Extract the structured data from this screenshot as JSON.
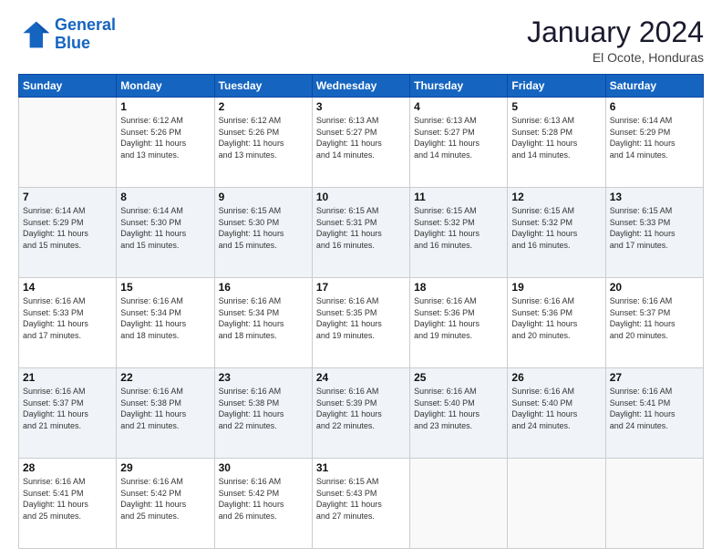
{
  "logo": {
    "line1": "General",
    "line2": "Blue"
  },
  "header": {
    "month": "January 2024",
    "location": "El Ocote, Honduras"
  },
  "weekdays": [
    "Sunday",
    "Monday",
    "Tuesday",
    "Wednesday",
    "Thursday",
    "Friday",
    "Saturday"
  ],
  "weeks": [
    [
      {
        "day": "",
        "sunrise": "",
        "sunset": "",
        "daylight": ""
      },
      {
        "day": "1",
        "sunrise": "Sunrise: 6:12 AM",
        "sunset": "Sunset: 5:26 PM",
        "daylight": "Daylight: 11 hours and 13 minutes."
      },
      {
        "day": "2",
        "sunrise": "Sunrise: 6:12 AM",
        "sunset": "Sunset: 5:26 PM",
        "daylight": "Daylight: 11 hours and 13 minutes."
      },
      {
        "day": "3",
        "sunrise": "Sunrise: 6:13 AM",
        "sunset": "Sunset: 5:27 PM",
        "daylight": "Daylight: 11 hours and 14 minutes."
      },
      {
        "day": "4",
        "sunrise": "Sunrise: 6:13 AM",
        "sunset": "Sunset: 5:27 PM",
        "daylight": "Daylight: 11 hours and 14 minutes."
      },
      {
        "day": "5",
        "sunrise": "Sunrise: 6:13 AM",
        "sunset": "Sunset: 5:28 PM",
        "daylight": "Daylight: 11 hours and 14 minutes."
      },
      {
        "day": "6",
        "sunrise": "Sunrise: 6:14 AM",
        "sunset": "Sunset: 5:29 PM",
        "daylight": "Daylight: 11 hours and 14 minutes."
      }
    ],
    [
      {
        "day": "7",
        "sunrise": "Sunrise: 6:14 AM",
        "sunset": "Sunset: 5:29 PM",
        "daylight": "Daylight: 11 hours and 15 minutes."
      },
      {
        "day": "8",
        "sunrise": "Sunrise: 6:14 AM",
        "sunset": "Sunset: 5:30 PM",
        "daylight": "Daylight: 11 hours and 15 minutes."
      },
      {
        "day": "9",
        "sunrise": "Sunrise: 6:15 AM",
        "sunset": "Sunset: 5:30 PM",
        "daylight": "Daylight: 11 hours and 15 minutes."
      },
      {
        "day": "10",
        "sunrise": "Sunrise: 6:15 AM",
        "sunset": "Sunset: 5:31 PM",
        "daylight": "Daylight: 11 hours and 16 minutes."
      },
      {
        "day": "11",
        "sunrise": "Sunrise: 6:15 AM",
        "sunset": "Sunset: 5:32 PM",
        "daylight": "Daylight: 11 hours and 16 minutes."
      },
      {
        "day": "12",
        "sunrise": "Sunrise: 6:15 AM",
        "sunset": "Sunset: 5:32 PM",
        "daylight": "Daylight: 11 hours and 16 minutes."
      },
      {
        "day": "13",
        "sunrise": "Sunrise: 6:15 AM",
        "sunset": "Sunset: 5:33 PM",
        "daylight": "Daylight: 11 hours and 17 minutes."
      }
    ],
    [
      {
        "day": "14",
        "sunrise": "Sunrise: 6:16 AM",
        "sunset": "Sunset: 5:33 PM",
        "daylight": "Daylight: 11 hours and 17 minutes."
      },
      {
        "day": "15",
        "sunrise": "Sunrise: 6:16 AM",
        "sunset": "Sunset: 5:34 PM",
        "daylight": "Daylight: 11 hours and 18 minutes."
      },
      {
        "day": "16",
        "sunrise": "Sunrise: 6:16 AM",
        "sunset": "Sunset: 5:34 PM",
        "daylight": "Daylight: 11 hours and 18 minutes."
      },
      {
        "day": "17",
        "sunrise": "Sunrise: 6:16 AM",
        "sunset": "Sunset: 5:35 PM",
        "daylight": "Daylight: 11 hours and 19 minutes."
      },
      {
        "day": "18",
        "sunrise": "Sunrise: 6:16 AM",
        "sunset": "Sunset: 5:36 PM",
        "daylight": "Daylight: 11 hours and 19 minutes."
      },
      {
        "day": "19",
        "sunrise": "Sunrise: 6:16 AM",
        "sunset": "Sunset: 5:36 PM",
        "daylight": "Daylight: 11 hours and 20 minutes."
      },
      {
        "day": "20",
        "sunrise": "Sunrise: 6:16 AM",
        "sunset": "Sunset: 5:37 PM",
        "daylight": "Daylight: 11 hours and 20 minutes."
      }
    ],
    [
      {
        "day": "21",
        "sunrise": "Sunrise: 6:16 AM",
        "sunset": "Sunset: 5:37 PM",
        "daylight": "Daylight: 11 hours and 21 minutes."
      },
      {
        "day": "22",
        "sunrise": "Sunrise: 6:16 AM",
        "sunset": "Sunset: 5:38 PM",
        "daylight": "Daylight: 11 hours and 21 minutes."
      },
      {
        "day": "23",
        "sunrise": "Sunrise: 6:16 AM",
        "sunset": "Sunset: 5:38 PM",
        "daylight": "Daylight: 11 hours and 22 minutes."
      },
      {
        "day": "24",
        "sunrise": "Sunrise: 6:16 AM",
        "sunset": "Sunset: 5:39 PM",
        "daylight": "Daylight: 11 hours and 22 minutes."
      },
      {
        "day": "25",
        "sunrise": "Sunrise: 6:16 AM",
        "sunset": "Sunset: 5:40 PM",
        "daylight": "Daylight: 11 hours and 23 minutes."
      },
      {
        "day": "26",
        "sunrise": "Sunrise: 6:16 AM",
        "sunset": "Sunset: 5:40 PM",
        "daylight": "Daylight: 11 hours and 24 minutes."
      },
      {
        "day": "27",
        "sunrise": "Sunrise: 6:16 AM",
        "sunset": "Sunset: 5:41 PM",
        "daylight": "Daylight: 11 hours and 24 minutes."
      }
    ],
    [
      {
        "day": "28",
        "sunrise": "Sunrise: 6:16 AM",
        "sunset": "Sunset: 5:41 PM",
        "daylight": "Daylight: 11 hours and 25 minutes."
      },
      {
        "day": "29",
        "sunrise": "Sunrise: 6:16 AM",
        "sunset": "Sunset: 5:42 PM",
        "daylight": "Daylight: 11 hours and 25 minutes."
      },
      {
        "day": "30",
        "sunrise": "Sunrise: 6:16 AM",
        "sunset": "Sunset: 5:42 PM",
        "daylight": "Daylight: 11 hours and 26 minutes."
      },
      {
        "day": "31",
        "sunrise": "Sunrise: 6:15 AM",
        "sunset": "Sunset: 5:43 PM",
        "daylight": "Daylight: 11 hours and 27 minutes."
      },
      {
        "day": "",
        "sunrise": "",
        "sunset": "",
        "daylight": ""
      },
      {
        "day": "",
        "sunrise": "",
        "sunset": "",
        "daylight": ""
      },
      {
        "day": "",
        "sunrise": "",
        "sunset": "",
        "daylight": ""
      }
    ]
  ]
}
